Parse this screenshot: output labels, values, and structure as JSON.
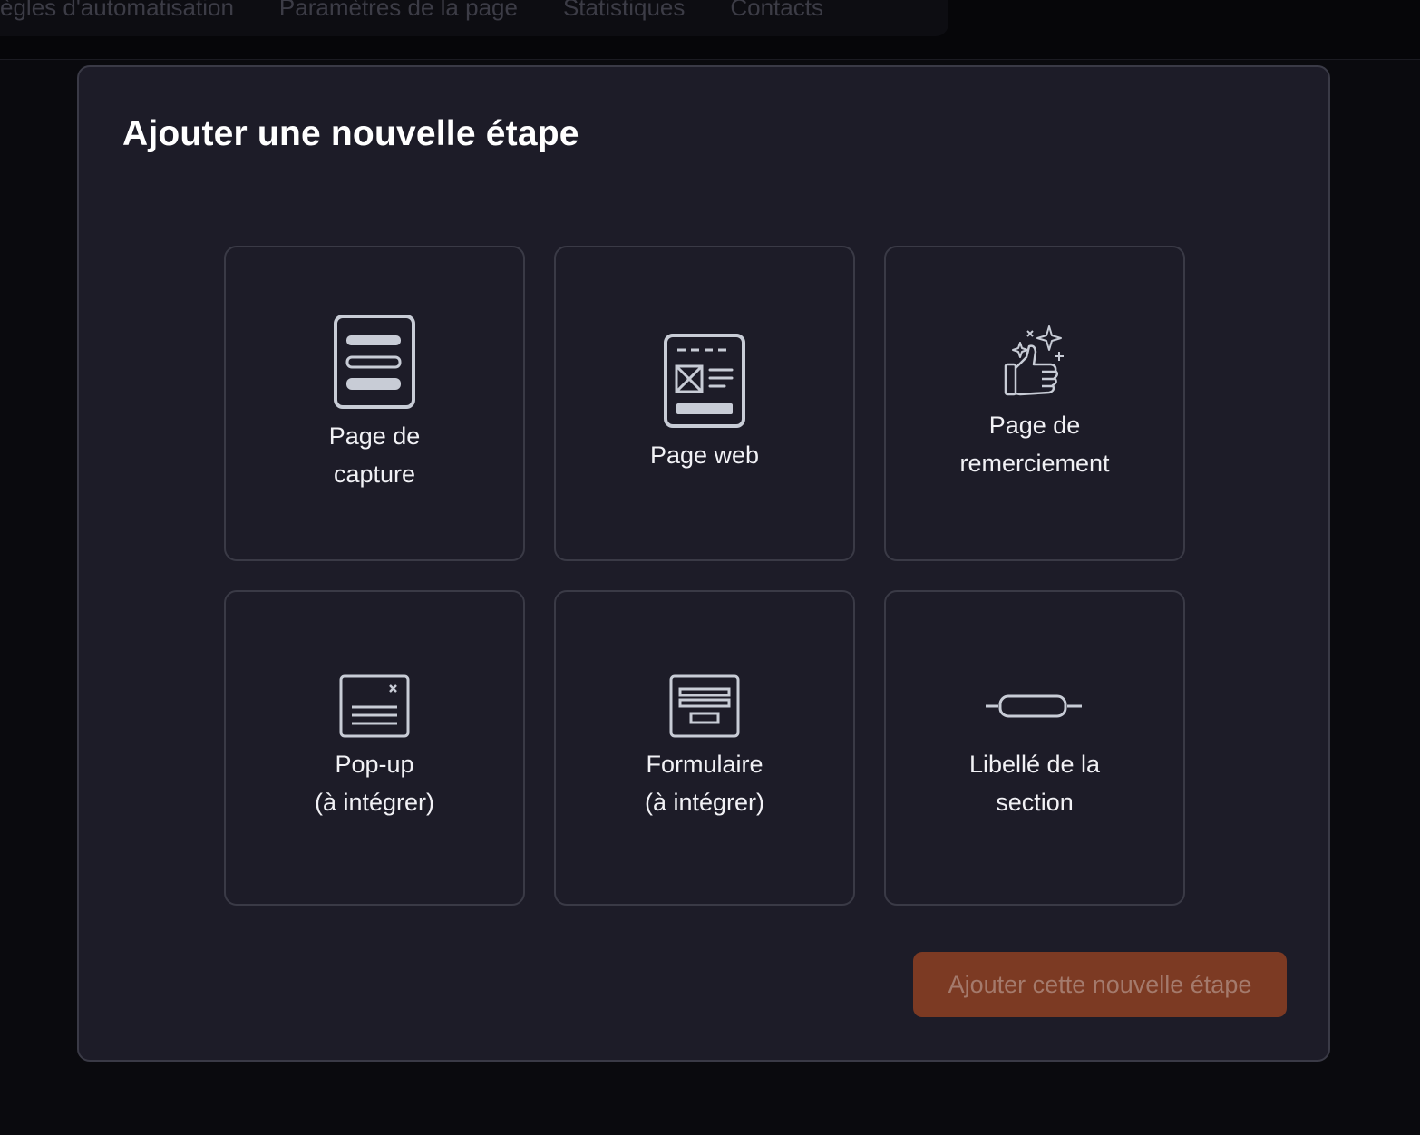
{
  "nav": {
    "tabs": [
      "ègles d'automatisation",
      "Paramètres de la page",
      "Statistiques",
      "Contacts"
    ]
  },
  "modal": {
    "title": "Ajouter une nouvelle étape",
    "options": [
      {
        "label": "Page de\ncapture",
        "icon": "capture-page-icon"
      },
      {
        "label": "Page web",
        "icon": "web-page-icon"
      },
      {
        "label": "Page de\nremerciement",
        "icon": "thumbs-up-sparkles-icon"
      },
      {
        "label": "Pop-up\n(à intégrer)",
        "icon": "popup-icon"
      },
      {
        "label": "Formulaire\n(à intégrer)",
        "icon": "form-icon"
      },
      {
        "label": "Libellé de la\nsection",
        "icon": "section-label-icon"
      }
    ],
    "submit_label": "Ajouter cette nouvelle étape"
  },
  "colors": {
    "background": "#0a0a0e",
    "modal_bg": "#1d1c28",
    "border": "#3a3a46",
    "icon": "#c8ccd6",
    "button_bg": "#7c3a23",
    "button_text": "#a47a6c"
  }
}
